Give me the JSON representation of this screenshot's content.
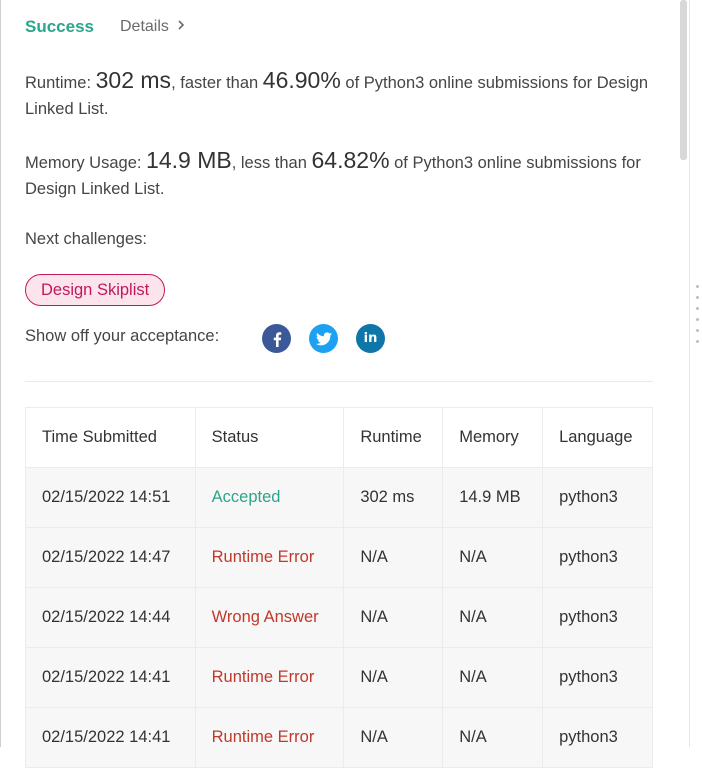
{
  "header": {
    "status": "Success",
    "details_label": "Details"
  },
  "runtime": {
    "label": "Runtime:",
    "value": "302 ms",
    "mid_text": ", faster than",
    "percent": "46.90%",
    "tail_text": "of Python3 online submissions for Design Linked List."
  },
  "memory": {
    "label": "Memory Usage:",
    "value": "14.9 MB",
    "mid_text": ", less than",
    "percent": "64.82%",
    "tail_text": "of Python3 online submissions for Design Linked List."
  },
  "next": {
    "label": "Next challenges:",
    "challenge": "Design Skiplist"
  },
  "share": {
    "label": "Show off your acceptance:",
    "icons": [
      "facebook-icon",
      "twitter-icon",
      "linkedin-icon"
    ]
  },
  "table": {
    "headers": [
      "Time Submitted",
      "Status",
      "Runtime",
      "Memory",
      "Language"
    ],
    "rows": [
      {
        "time": "02/15/2022 14:51",
        "status": "Accepted",
        "runtime": "302 ms",
        "memory": "14.9 MB",
        "language": "python3"
      },
      {
        "time": "02/15/2022 14:47",
        "status": "Runtime Error",
        "runtime": "N/A",
        "memory": "N/A",
        "language": "python3"
      },
      {
        "time": "02/15/2022 14:44",
        "status": "Wrong Answer",
        "runtime": "N/A",
        "memory": "N/A",
        "language": "python3"
      },
      {
        "time": "02/15/2022 14:41",
        "status": "Runtime Error",
        "runtime": "N/A",
        "memory": "N/A",
        "language": "python3"
      },
      {
        "time": "02/15/2022 14:41",
        "status": "Runtime Error",
        "runtime": "N/A",
        "memory": "N/A",
        "language": "python3"
      }
    ]
  },
  "colors": {
    "success": "#2ba58b",
    "error": "#c0392b",
    "pill_border": "#c2185b",
    "pill_bg": "#fce4ec"
  }
}
